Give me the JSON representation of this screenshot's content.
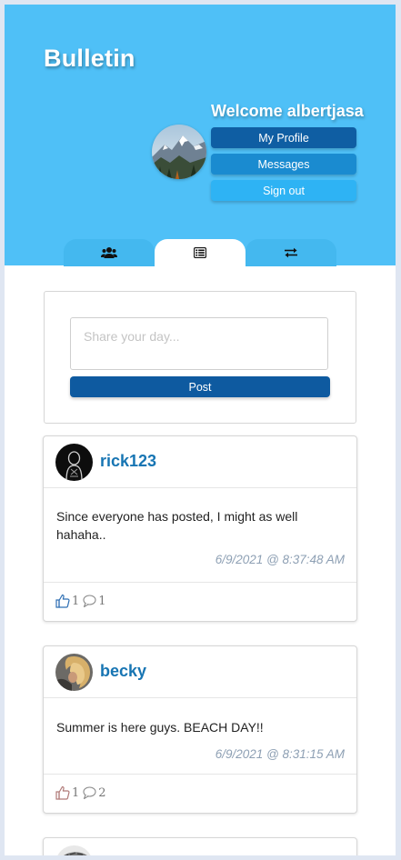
{
  "app": {
    "title": "Bulletin"
  },
  "user": {
    "welcome": "Welcome albertjasa"
  },
  "menu": {
    "profile": "My Profile",
    "messages": "Messages",
    "signout": "Sign out"
  },
  "tabs": [
    {
      "icon": "users-icon",
      "active": false
    },
    {
      "icon": "list-icon",
      "active": true
    },
    {
      "icon": "swap-arrows-icon",
      "active": false
    }
  ],
  "composer": {
    "placeholder": "Share your day...",
    "post_label": "Post"
  },
  "posts": [
    {
      "username": "rick123",
      "text": "Since everyone has posted, I might as well hahaha..",
      "timestamp": "6/9/2021 @ 8:37:48 AM",
      "likes": "1",
      "comments": "1",
      "liked": true
    },
    {
      "username": "becky",
      "text": "Summer is here guys. BEACH DAY!!",
      "timestamp": "6/9/2021 @ 8:31:15 AM",
      "likes": "1",
      "comments": "2",
      "liked": false
    }
  ],
  "colors": {
    "header": "#4fc0f7",
    "primary": "#0e5aa0",
    "username": "#1775b3",
    "timestamp": "#8ea0b4"
  }
}
